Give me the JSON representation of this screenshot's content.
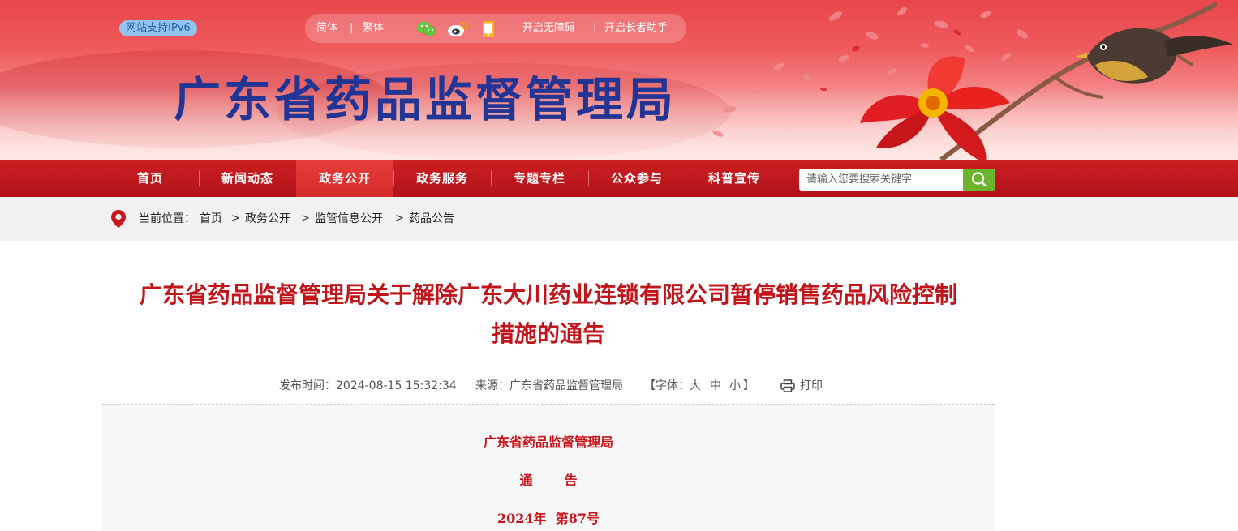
{
  "header": {
    "ipv6_badge": "网站支持IPv6",
    "lang_simplified": "简体",
    "lang_traditional": "繁体",
    "separator": "|",
    "accessibility": "开启无障碍",
    "elderly_mode": "开启长者助手",
    "site_title": "广东省药品监督管理局",
    "icons": [
      "wechat-icon",
      "weibo-icon",
      "mobile-icon"
    ]
  },
  "nav": {
    "items": [
      "首页",
      "新闻动态",
      "政务公开",
      "政务服务",
      "专题专栏",
      "公众参与",
      "科普宣传"
    ],
    "active": "政务公开",
    "search_placeholder": "请输入您要搜索关键字"
  },
  "breadcrumb": {
    "prefix": "当前位置：",
    "items": [
      "首页",
      "政务公开",
      "监管信息公开",
      "药品公告"
    ],
    "separator": ">"
  },
  "article": {
    "title_line1": "广东省药品监督管理局关于解除广东大川药业连锁有限公司暂停销售药品风险控制",
    "title_line2": "措施的通告",
    "publish_time": "发布时间：2024-08-15 15:32:34",
    "source": "来源：广东省药品监督管理局",
    "font_size_label": "【字体：",
    "font_large": "大",
    "font_medium": "中",
    "font_small": "小",
    "font_close": "】",
    "print": "打印",
    "body": {
      "issuer": "广东省药品监督管理局",
      "doc_type": "通       告",
      "doc_number": "2024年  第87号"
    }
  },
  "colors": {
    "nav_red": "#b1121a",
    "title_red": "#c0161b",
    "site_title_blue": "#233594",
    "search_green": "#6ab52d"
  }
}
